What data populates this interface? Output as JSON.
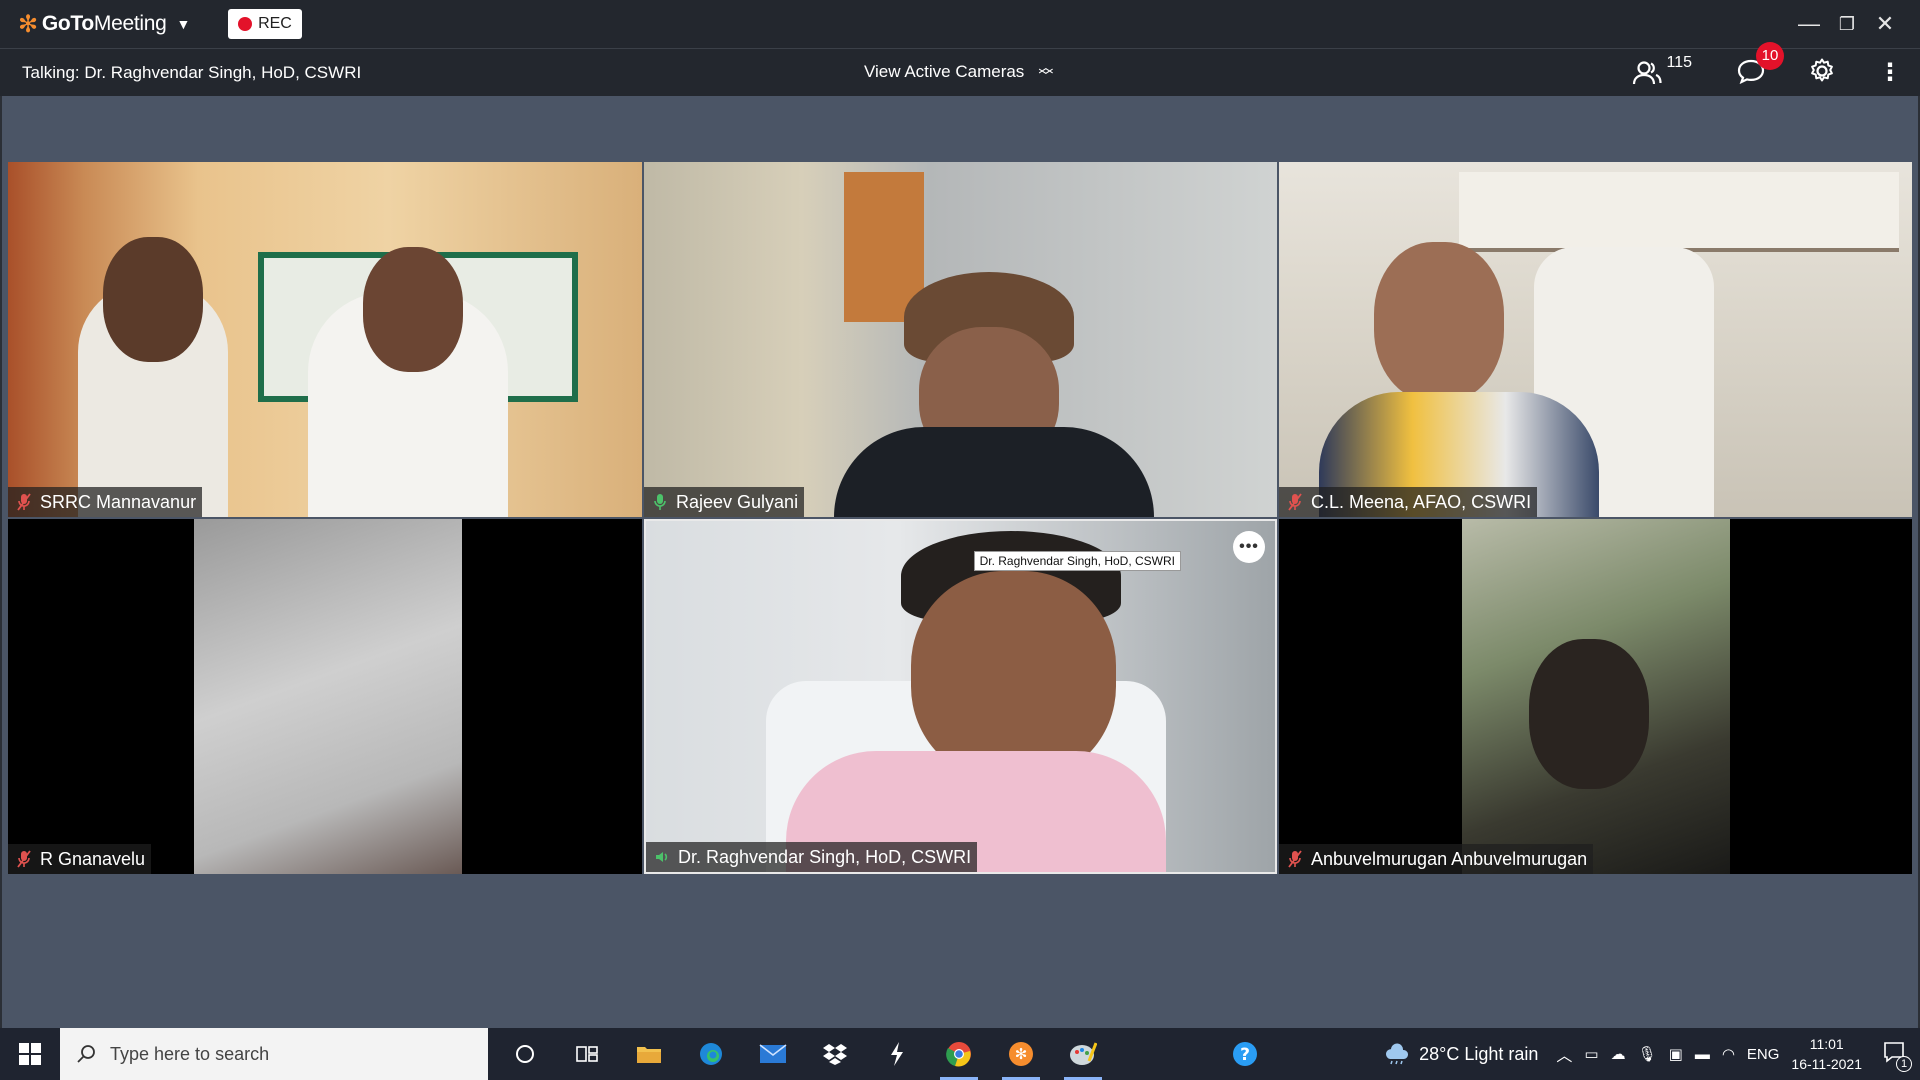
{
  "app": {
    "brand_goto": "GoTo",
    "brand_meeting": "Meeting",
    "rec_label": "REC"
  },
  "toolbar": {
    "talking": "Talking: Dr. Raghvendar Singh, HoD, CSWRI",
    "view_cameras": "View Active Cameras",
    "attendee_count": "115",
    "chat_badge": "10"
  },
  "tiles": [
    {
      "name": "SRRC Mannavanur",
      "mic": "muted"
    },
    {
      "name": "Rajeev Gulyani",
      "mic": "on"
    },
    {
      "name": "C.L. Meena, AFAO, CSWRI",
      "mic": "muted"
    },
    {
      "name": "R Gnanavelu",
      "mic": "muted"
    },
    {
      "name": "Dr. Raghvendar Singh, HoD, CSWRI",
      "mic": "speaking",
      "tooltip": "Dr. Raghvendar Singh, HoD, CSWRI"
    },
    {
      "name": "Anbuvelmurugan Anbuvelmurugan",
      "mic": "muted"
    }
  ],
  "colors": {
    "rec_dot": "#e3122a",
    "muted_mic": "#e0524f",
    "active_mic": "#4cc26a",
    "brand_flower": "#f68d2e",
    "stage_bg": "#4b5566"
  },
  "taskbar": {
    "search_placeholder": "Type here to search",
    "weather": "28°C  Light rain",
    "lang": "ENG",
    "time": "11:01",
    "date": "16-11-2021",
    "notif_count": "1"
  }
}
